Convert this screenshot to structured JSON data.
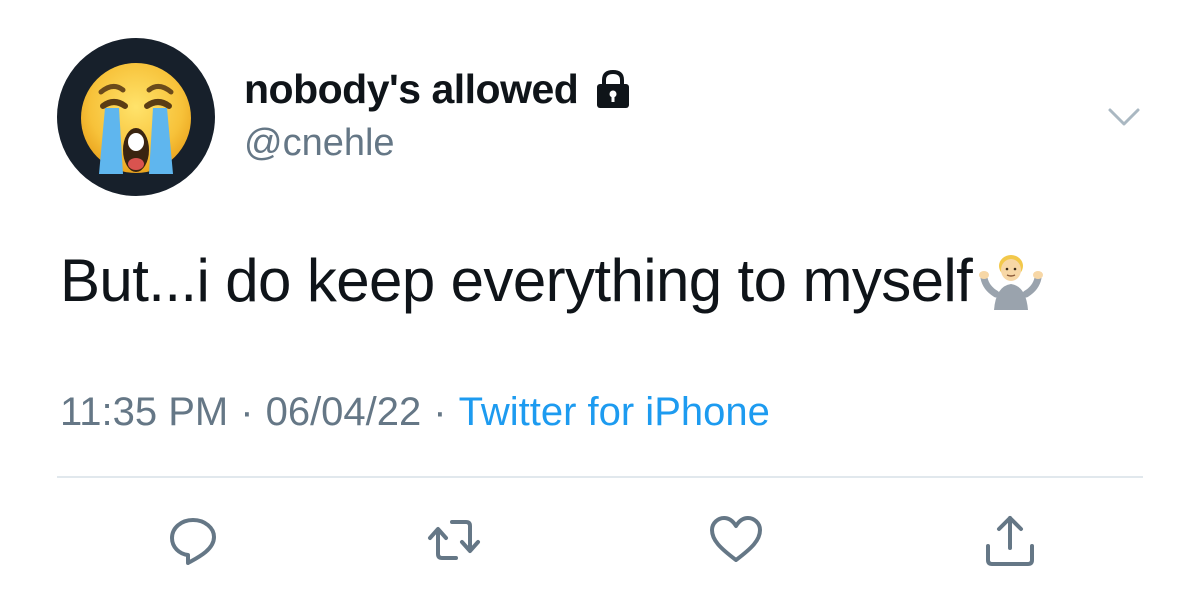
{
  "user": {
    "display_name": "nobody's allowed",
    "handle": "@cnehle",
    "avatar_icon": "loudly-crying-face-emoji",
    "protected_icon": "lock-icon"
  },
  "tweet": {
    "text": "But...i do keep everything to myself",
    "trailing_emoji": "person-shrugging-emoji"
  },
  "meta": {
    "time": "11:35 PM",
    "separator": "·",
    "date": "06/04/22",
    "source": "Twitter for iPhone"
  },
  "actions": {
    "reply_icon": "reply-icon",
    "retweet_icon": "retweet-icon",
    "like_icon": "heart-icon",
    "share_icon": "share-icon",
    "menu_icon": "chevron-down-icon"
  },
  "colors": {
    "text": "#0f1419",
    "secondary": "#657786",
    "link": "#1d9bf0",
    "divider": "#e1e8ed",
    "avatar_bg": "#17202b"
  }
}
